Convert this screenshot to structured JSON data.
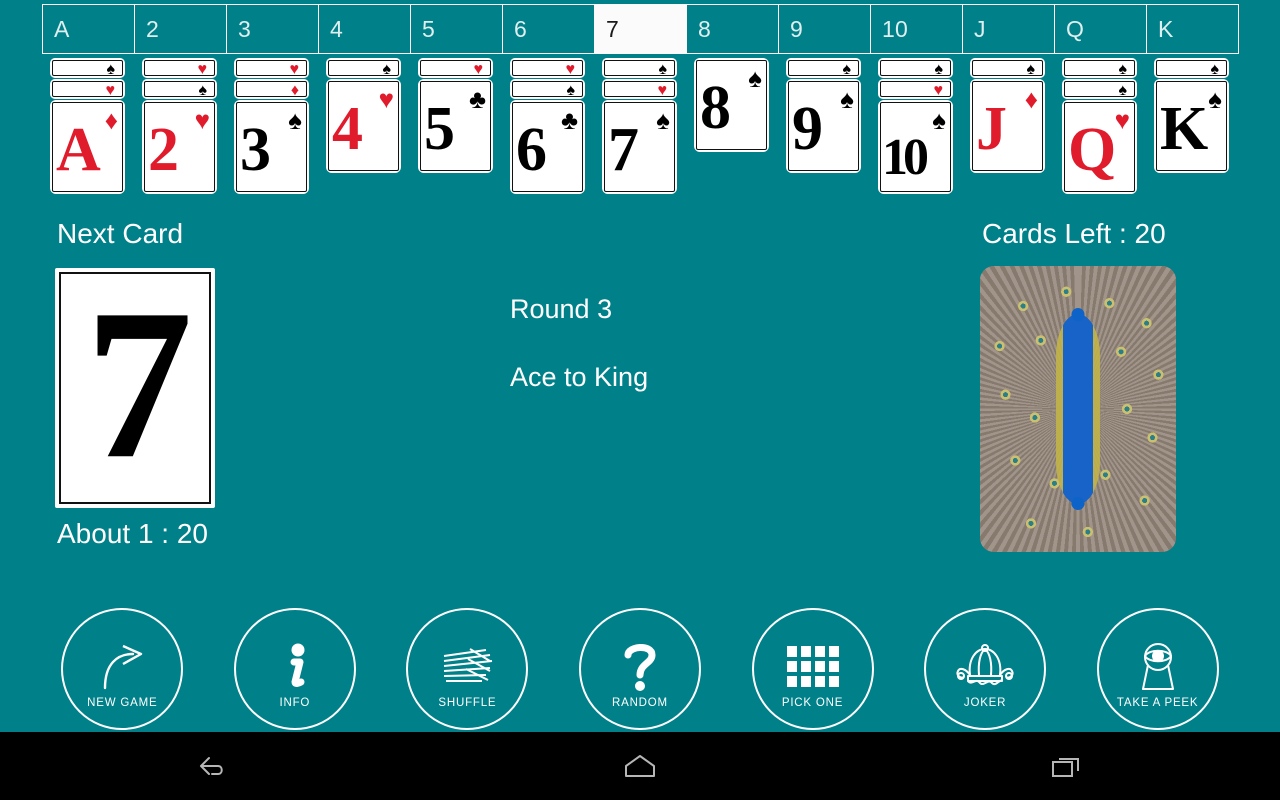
{
  "app": {
    "background_color": "#00818a",
    "accent_red": "#e01b2c",
    "accent_black": "#000000"
  },
  "columns": {
    "headers": [
      {
        "label": "A",
        "active": false
      },
      {
        "label": "2",
        "active": false
      },
      {
        "label": "3",
        "active": false
      },
      {
        "label": "4",
        "active": false
      },
      {
        "label": "5",
        "active": false
      },
      {
        "label": "6",
        "active": false
      },
      {
        "label": "7",
        "active": true
      },
      {
        "label": "8",
        "active": false
      },
      {
        "label": "9",
        "active": false
      },
      {
        "label": "10",
        "active": false
      },
      {
        "label": "J",
        "active": false
      },
      {
        "label": "Q",
        "active": false
      },
      {
        "label": "K",
        "active": false
      }
    ],
    "stacks": [
      {
        "rank": "A",
        "face_suit": "diamond-icon",
        "face_color": "red",
        "buried": [
          {
            "suit": "spade-icon",
            "color": "black"
          },
          {
            "suit": "heart-icon",
            "color": "red"
          }
        ]
      },
      {
        "rank": "2",
        "face_suit": "heart-icon",
        "face_color": "red",
        "buried": [
          {
            "suit": "heart-icon",
            "color": "red"
          },
          {
            "suit": "spade-icon",
            "color": "black"
          }
        ]
      },
      {
        "rank": "3",
        "face_suit": "spade-icon",
        "face_color": "black",
        "buried": [
          {
            "suit": "heart-icon",
            "color": "red"
          },
          {
            "suit": "diamond-icon",
            "color": "red"
          }
        ]
      },
      {
        "rank": "4",
        "face_suit": "heart-icon",
        "face_color": "red",
        "buried": [
          {
            "suit": "spade-icon",
            "color": "black"
          }
        ]
      },
      {
        "rank": "5",
        "face_suit": "club-icon",
        "face_color": "black",
        "buried": [
          {
            "suit": "heart-icon",
            "color": "red"
          }
        ]
      },
      {
        "rank": "6",
        "face_suit": "club-icon",
        "face_color": "black",
        "buried": [
          {
            "suit": "heart-icon",
            "color": "red"
          },
          {
            "suit": "spade-icon",
            "color": "black"
          }
        ]
      },
      {
        "rank": "7",
        "face_suit": "spade-icon",
        "face_color": "black",
        "buried": [
          {
            "suit": "spade-icon",
            "color": "black"
          },
          {
            "suit": "heart-icon",
            "color": "red"
          }
        ]
      },
      {
        "rank": "8",
        "face_suit": "spade-icon",
        "face_color": "black",
        "buried": []
      },
      {
        "rank": "9",
        "face_suit": "spade-icon",
        "face_color": "black",
        "buried": [
          {
            "suit": "spade-icon",
            "color": "black"
          }
        ]
      },
      {
        "rank": "10",
        "face_suit": "spade-icon",
        "face_color": "black",
        "buried": [
          {
            "suit": "spade-icon",
            "color": "black"
          },
          {
            "suit": "heart-icon",
            "color": "red"
          }
        ]
      },
      {
        "rank": "J",
        "face_suit": "diamond-icon",
        "face_color": "red",
        "buried": [
          {
            "suit": "spade-icon",
            "color": "black"
          }
        ]
      },
      {
        "rank": "Q",
        "face_suit": "heart-icon",
        "face_color": "red",
        "buried": [
          {
            "suit": "spade-icon",
            "color": "black"
          },
          {
            "suit": "spade-icon",
            "color": "black"
          }
        ]
      },
      {
        "rank": "K",
        "face_suit": "spade-icon",
        "face_color": "black",
        "buried": [
          {
            "suit": "spade-icon",
            "color": "black"
          }
        ]
      }
    ]
  },
  "next_card": {
    "label": "Next Card",
    "rank": "7",
    "color": "black",
    "odds_label": "About 1 :  20"
  },
  "status": {
    "round": "Round 3",
    "mode": "Ace to King",
    "cards_left": "Cards Left :  20"
  },
  "deck": {
    "back_image": "peacock-card-back"
  },
  "toolbar": {
    "buttons": [
      {
        "label": "NEW GAME",
        "icon": "curved-arrow-icon"
      },
      {
        "label": "INFO",
        "icon": "info-icon"
      },
      {
        "label": "SHUFFLE",
        "icon": "shuffle-lines-icon"
      },
      {
        "label": "RANDOM",
        "icon": "question-mark-icon"
      },
      {
        "label": "PICK ONE",
        "icon": "grid-icon"
      },
      {
        "label": "JOKER",
        "icon": "jester-hat-icon"
      },
      {
        "label": "TAKE A PEEK",
        "icon": "keyhole-eye-icon"
      }
    ]
  },
  "navbar": {
    "buttons": [
      {
        "name": "back",
        "icon": "back-arrow-icon"
      },
      {
        "name": "home",
        "icon": "home-icon"
      },
      {
        "name": "recents",
        "icon": "recents-icon"
      }
    ]
  }
}
